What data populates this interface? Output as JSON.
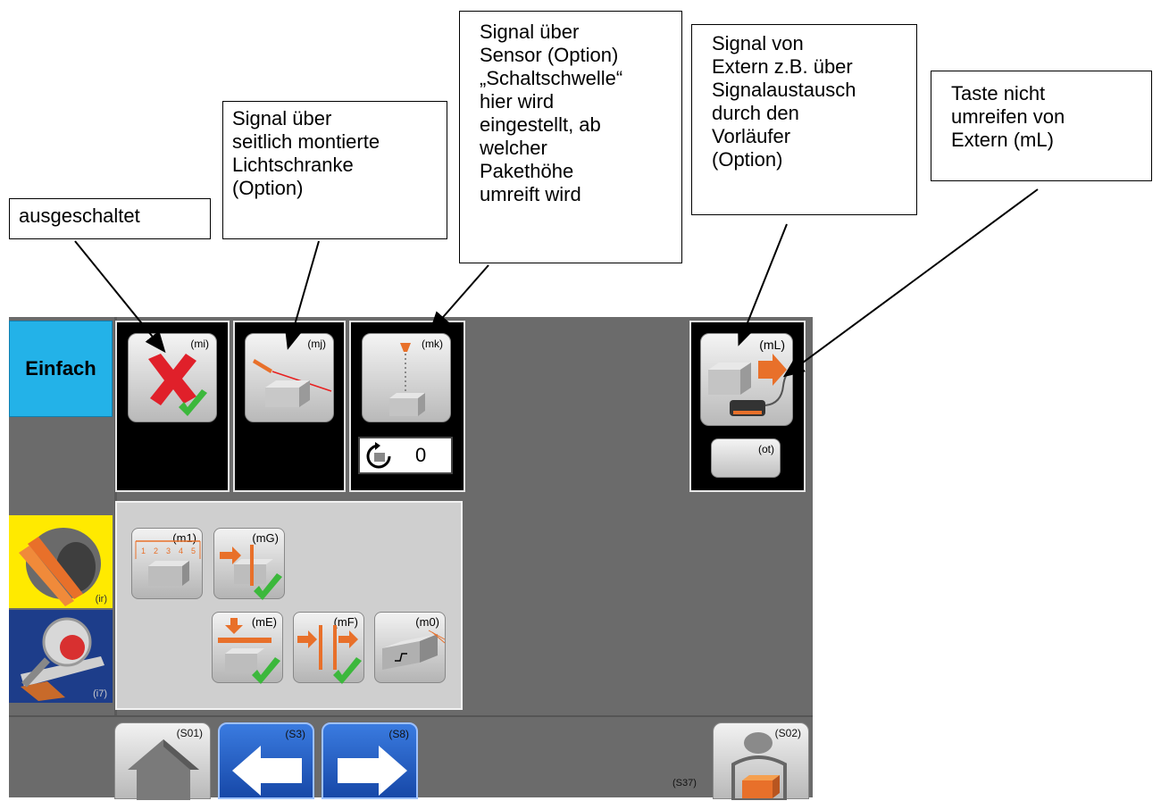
{
  "callouts": {
    "off": "ausgeschaltet",
    "light_barrier": [
      "Signal über",
      "seitlich montierte",
      "Lichtschranke",
      "(Option)"
    ],
    "sensor": [
      "Signal über",
      "Sensor (Option)",
      "„Schaltschwelle“",
      "hier wird",
      "eingestellt, ab",
      "welcher",
      "Pakethöhe",
      "umreift wird"
    ],
    "external": [
      "Signal von",
      "Extern z.B. über",
      "Signalaustausch",
      "durch den",
      "Vorläufer",
      "(Option)"
    ],
    "button": [
      "Taste nicht",
      "umreifen von",
      "Extern (mL)"
    ]
  },
  "screen": {
    "mode_label": "Einfach",
    "side_buttons": {
      "strap": "(ir)",
      "inspect": "(i7)"
    },
    "tiles": {
      "mi": "(mi)",
      "mj": "(mj)",
      "mk": "(mk)",
      "mL": "(mL)",
      "ot": "(ot)"
    },
    "counter_value": "0",
    "lower_tiles": {
      "m1": "(m1)",
      "mG": "(mG)",
      "mE": "(mE)",
      "mF": "(mF)",
      "m0": "(m0)"
    },
    "ruler_numbers": [
      "1",
      "2",
      "3",
      "4",
      "5"
    ],
    "nav": {
      "home": "(S01)",
      "back": "(S3)",
      "forward": "(S8)",
      "user": "(S02)",
      "s37": "(S37)"
    }
  },
  "colors": {
    "mode_blue": "#23b2e8",
    "accent_orange": "#e8702a",
    "check_green": "#3cb83c",
    "cross_red": "#e0202a"
  }
}
